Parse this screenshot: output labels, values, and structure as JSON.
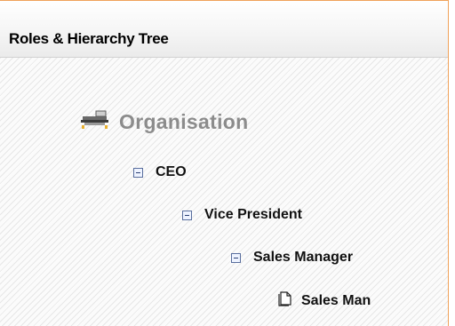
{
  "header": {
    "title": "Roles & Hierarchy Tree"
  },
  "tree": {
    "root": {
      "label": "Organisation",
      "icon": "organisation-icon"
    },
    "nodes": [
      {
        "label": "CEO",
        "icon": "collapse-toggle-icon",
        "expanded": true
      },
      {
        "label": "Vice President",
        "icon": "collapse-toggle-icon",
        "expanded": true
      },
      {
        "label": "Sales Manager",
        "icon": "collapse-toggle-icon",
        "expanded": true
      },
      {
        "label": "Sales Man",
        "icon": "document-icon",
        "expanded": false
      }
    ]
  }
}
